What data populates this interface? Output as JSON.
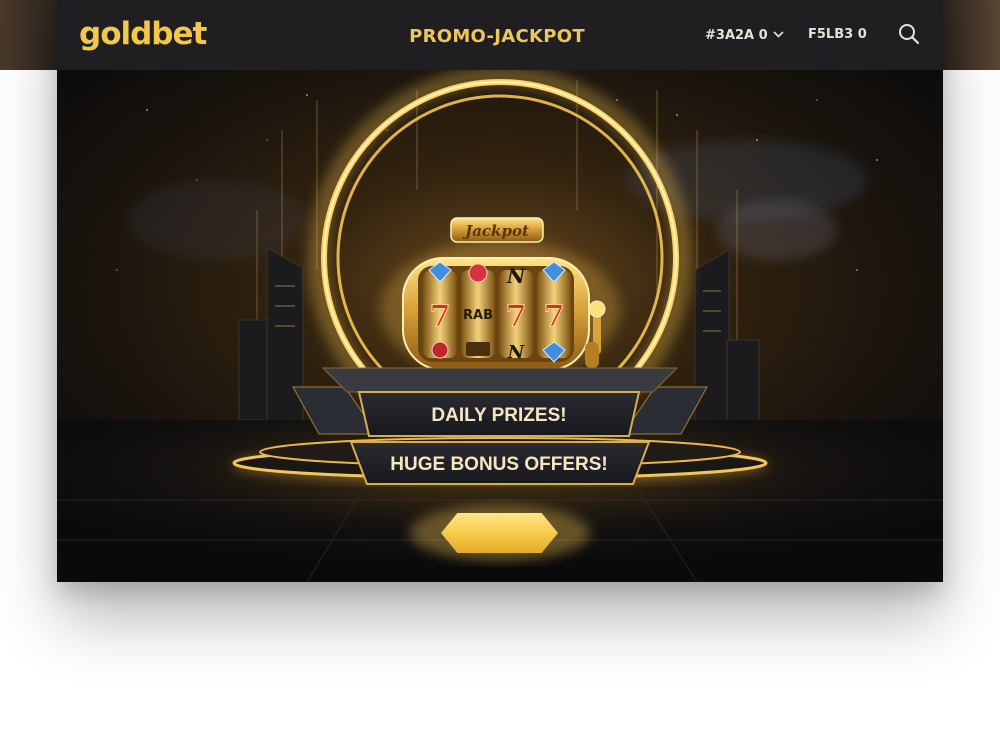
{
  "brand": {
    "logo": "goldbet"
  },
  "header": {
    "title": "PROMO-JACKPOT",
    "nav_a": "#3A2A 0",
    "nav_b": "F5LB3 0"
  },
  "hero": {
    "sign": "Jackpot",
    "reel_labels": [
      "7",
      "7",
      "7",
      "N",
      "N",
      "RAB"
    ],
    "banner_1": "DAILY PRIZES!",
    "banner_2": "HUGE BONUS OFFERS!"
  },
  "icons": {
    "search": "search-icon",
    "chevron": "chevron-down-icon"
  },
  "colors": {
    "gold": "#f2c74a",
    "header_bg": "#1f1f21",
    "banner_bg": "#1c1d22"
  }
}
